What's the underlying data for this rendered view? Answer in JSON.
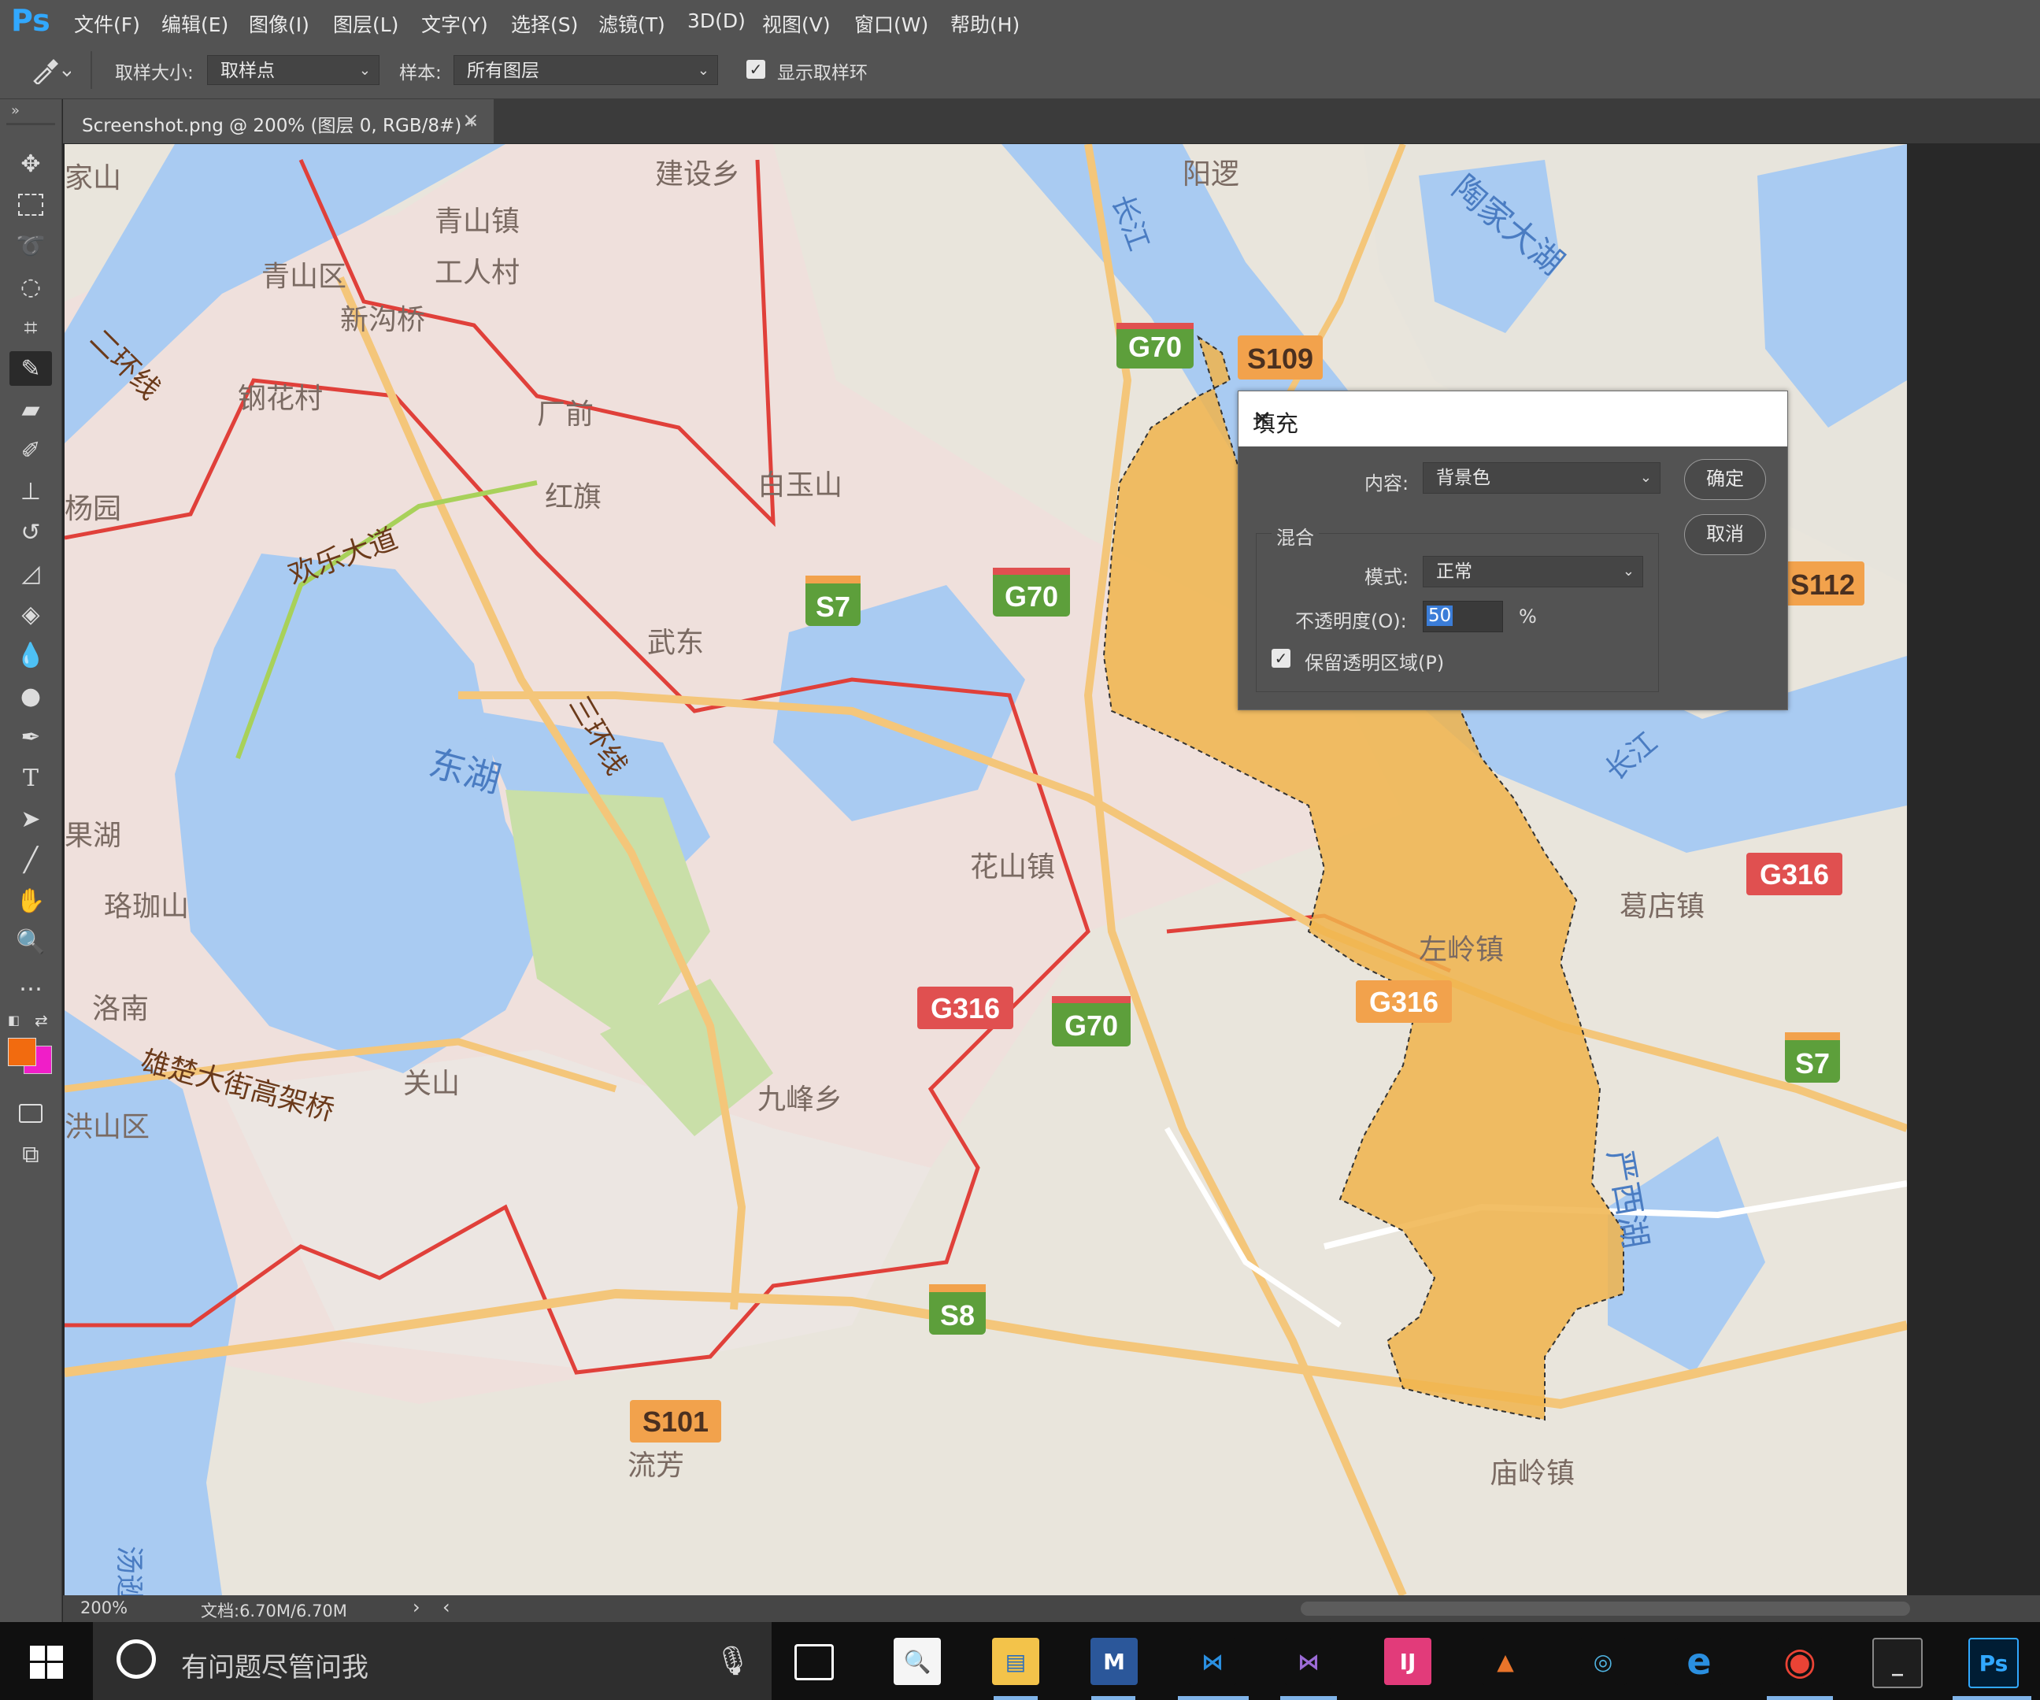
{
  "app": {
    "logo": "Ps"
  },
  "menu": [
    "文件(F)",
    "编辑(E)",
    "图像(I)",
    "图层(L)",
    "文字(Y)",
    "选择(S)",
    "滤镜(T)",
    "3D(D)",
    "视图(V)",
    "窗口(W)",
    "帮助(H)"
  ],
  "options": {
    "sample_size_label": "取样大小:",
    "sample_size_value": "取样点",
    "sample_label": "样本:",
    "sample_value": "所有图层",
    "show_ring_label": "显示取样环",
    "show_ring_checked": true
  },
  "tab": {
    "title": "Screenshot.png @ 200% (图层 0, RGB/8#) *",
    "close": "×"
  },
  "status": {
    "zoom": "200%",
    "doc": "文档:6.70M/6.70M",
    "arrow": "›",
    "left_arrow": "‹"
  },
  "colors": {
    "foreground": "#f26b0f",
    "background": "#f01ec8",
    "selection_fill": "#f0b44c"
  },
  "map": {
    "places": [
      "建设乡",
      "阳逻",
      "陶家大湖",
      "青山镇",
      "工人村",
      "青山区",
      "新沟桥",
      "钢花村",
      "厂前",
      "白玉山",
      "红旗",
      "欢乐大道",
      "武东",
      "二环线",
      "三环线",
      "东湖",
      "花山镇",
      "珞珈山",
      "果湖",
      "洛南",
      "关山",
      "雄楚大街高架桥",
      "九峰乡",
      "葛店镇",
      "左岭镇",
      "庙岭镇",
      "流芳",
      "严西湖",
      "长江",
      "长江",
      "杨园",
      "家山",
      "洪山区",
      "汤逊湖"
    ],
    "shields": [
      "G70",
      "S109",
      "S7",
      "G70",
      "S112",
      "G316",
      "G316",
      "G70",
      "G316",
      "S7",
      "S8",
      "S101"
    ]
  },
  "dialog": {
    "title": "填充",
    "content_label": "内容:",
    "content_value": "背景色",
    "ok": "确定",
    "cancel": "取消",
    "blend_label": "混合",
    "mode_label": "模式:",
    "mode_value": "正常",
    "opacity_label": "不透明度(O):",
    "opacity_value": "50",
    "opacity_unit": "%",
    "preserve_label": "保留透明区域(P)",
    "preserve_checked": true
  },
  "taskbar": {
    "search_placeholder": "有问题尽管问我",
    "apps": [
      "task-view",
      "search-magnifier",
      "file-explorer",
      "word-mail",
      "vscode",
      "visual-studio",
      "intellij",
      "matlab",
      "network-globe",
      "edge",
      "chrome",
      "terminal",
      "photoshop"
    ]
  }
}
